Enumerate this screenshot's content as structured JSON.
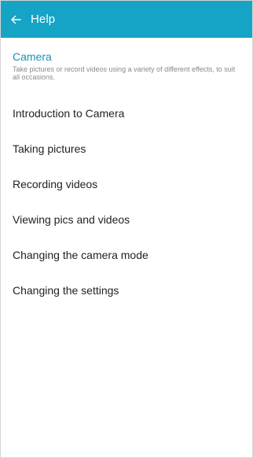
{
  "appbar": {
    "back_icon": "arrow-left-icon",
    "title": "Help"
  },
  "header": {
    "title": "Camera",
    "description": "Take pictures or record videos using a variety of different effects, to suit all occasions."
  },
  "topics": [
    {
      "label": "Introduction to Camera"
    },
    {
      "label": "Taking pictures"
    },
    {
      "label": "Recording videos"
    },
    {
      "label": "Viewing pics and videos"
    },
    {
      "label": "Changing the camera mode"
    },
    {
      "label": "Changing the settings"
    }
  ],
  "colors": {
    "appbar": "#15a4c6",
    "section_title": "#1593b4",
    "description": "#8a8a8a",
    "item_text": "#222222",
    "background": "#ffffff"
  }
}
